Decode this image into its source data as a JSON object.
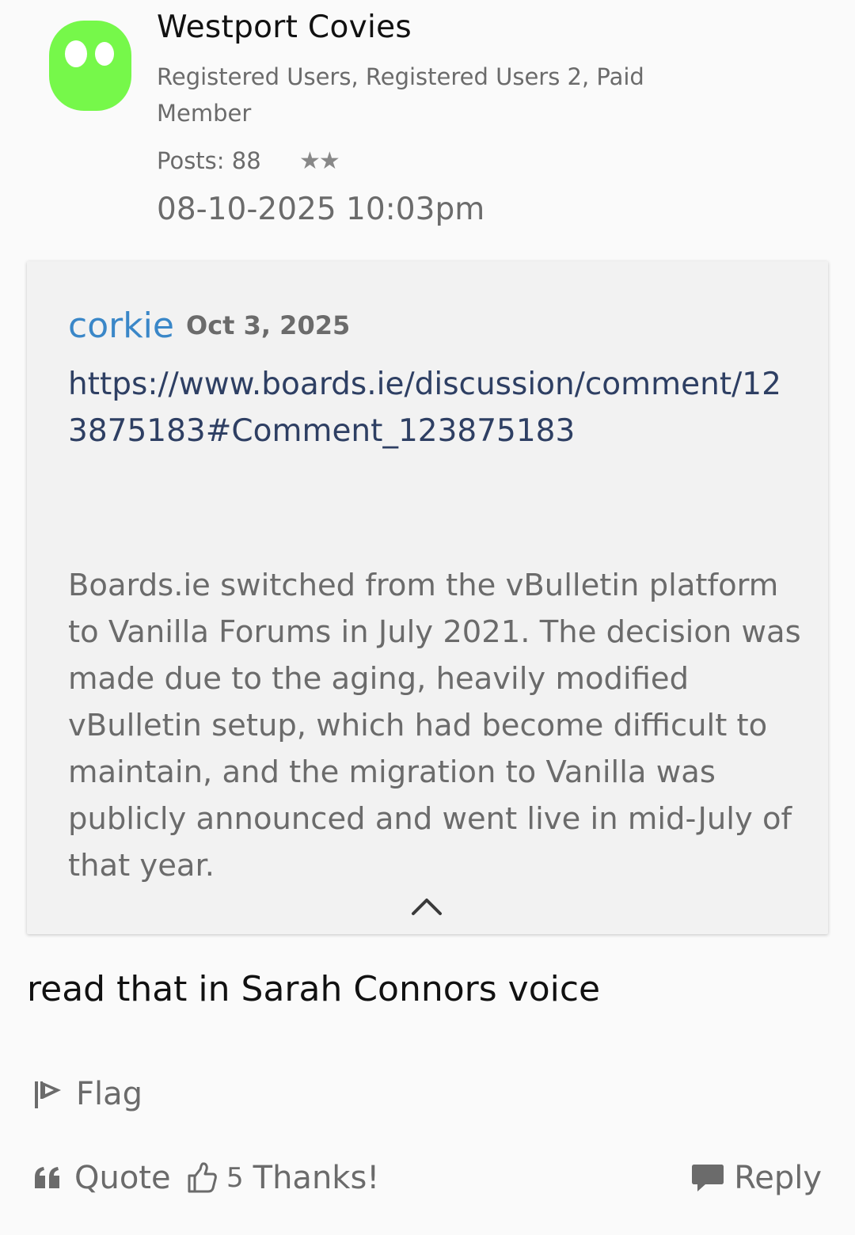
{
  "author": {
    "name": "Westport Covies",
    "roles": "Registered Users, Registered Users 2, Paid Member",
    "posts_label": "Posts: 88",
    "stars": "★★",
    "avatar_color": "#76f84a"
  },
  "post": {
    "date": "08-10-2025 10:03pm",
    "body": "read that in Sarah Connors voice"
  },
  "quote": {
    "author": "corkie",
    "date": "Oct 3, 2025",
    "link": "https://www.boards.ie/discussion/comment/123875183#Comment_123875183",
    "text": "Boards.ie switched from the vBulletin platform to Vanilla Forums in July 2021. The decision was made due to the aging, heavily modified vBulletin setup, which had become difficult to maintain, and the migration to Vanilla was publicly announced and went live in mid-July of that year."
  },
  "actions": {
    "flag": "Flag",
    "quote": "Quote",
    "thanks_count": "5",
    "thanks": "Thanks!",
    "reply": "Reply"
  },
  "icons": {
    "avatar": "alien-face-icon",
    "collapse": "chevron-up-icon",
    "flag": "flag-icon",
    "quote": "quote-icon",
    "thanks": "thumbs-up-icon",
    "reply": "speech-bubble-icon"
  },
  "colors": {
    "link": "#2e3f63",
    "quote_author": "#3a87c8",
    "muted": "#6b6b6b"
  }
}
